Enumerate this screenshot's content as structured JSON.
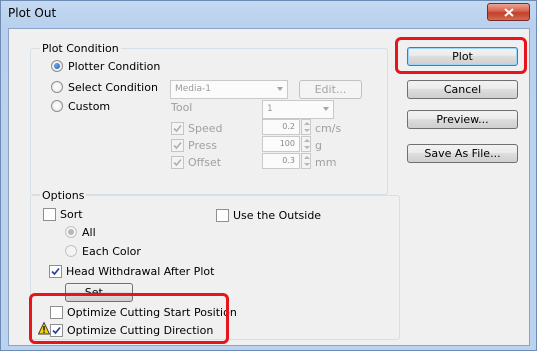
{
  "window": {
    "title": "Plot Out"
  },
  "plot_condition": {
    "group_label": "Plot Condition",
    "plotter_condition": "Plotter Condition",
    "select_condition": "Select Condition",
    "custom": "Custom",
    "media_value": "Media-1",
    "edit_label": "Edit...",
    "tool_label": "Tool",
    "tool_value": "1",
    "speed_label": "Speed",
    "speed_value": "0.2",
    "speed_unit": "cm/s",
    "press_label": "Press",
    "press_value": "100",
    "press_unit": "g",
    "offset_label": "Offset",
    "offset_value": "0.3",
    "offset_unit": "mm"
  },
  "buttons": {
    "plot": "Plot",
    "cancel": "Cancel",
    "preview": "Preview...",
    "save_as_file": "Save As File..."
  },
  "options": {
    "group_label": "Options",
    "sort": "Sort",
    "use_outside": "Use the Outside",
    "all": "All",
    "each_color": "Each Color",
    "head_withdrawal": "Head Withdrawal After Plot",
    "set_label": "Set...",
    "optimize_start": "Optimize Cutting Start Position",
    "optimize_direction": "Optimize Cutting Direction"
  },
  "icons": {
    "close": "close-icon",
    "warning": "warning-icon",
    "check": "check-icon",
    "dropdown": "chevron-down-icon"
  },
  "colors": {
    "highlight": "#e8141c",
    "title_bar": "#c4d9f1",
    "close_button": "#c1402b"
  }
}
